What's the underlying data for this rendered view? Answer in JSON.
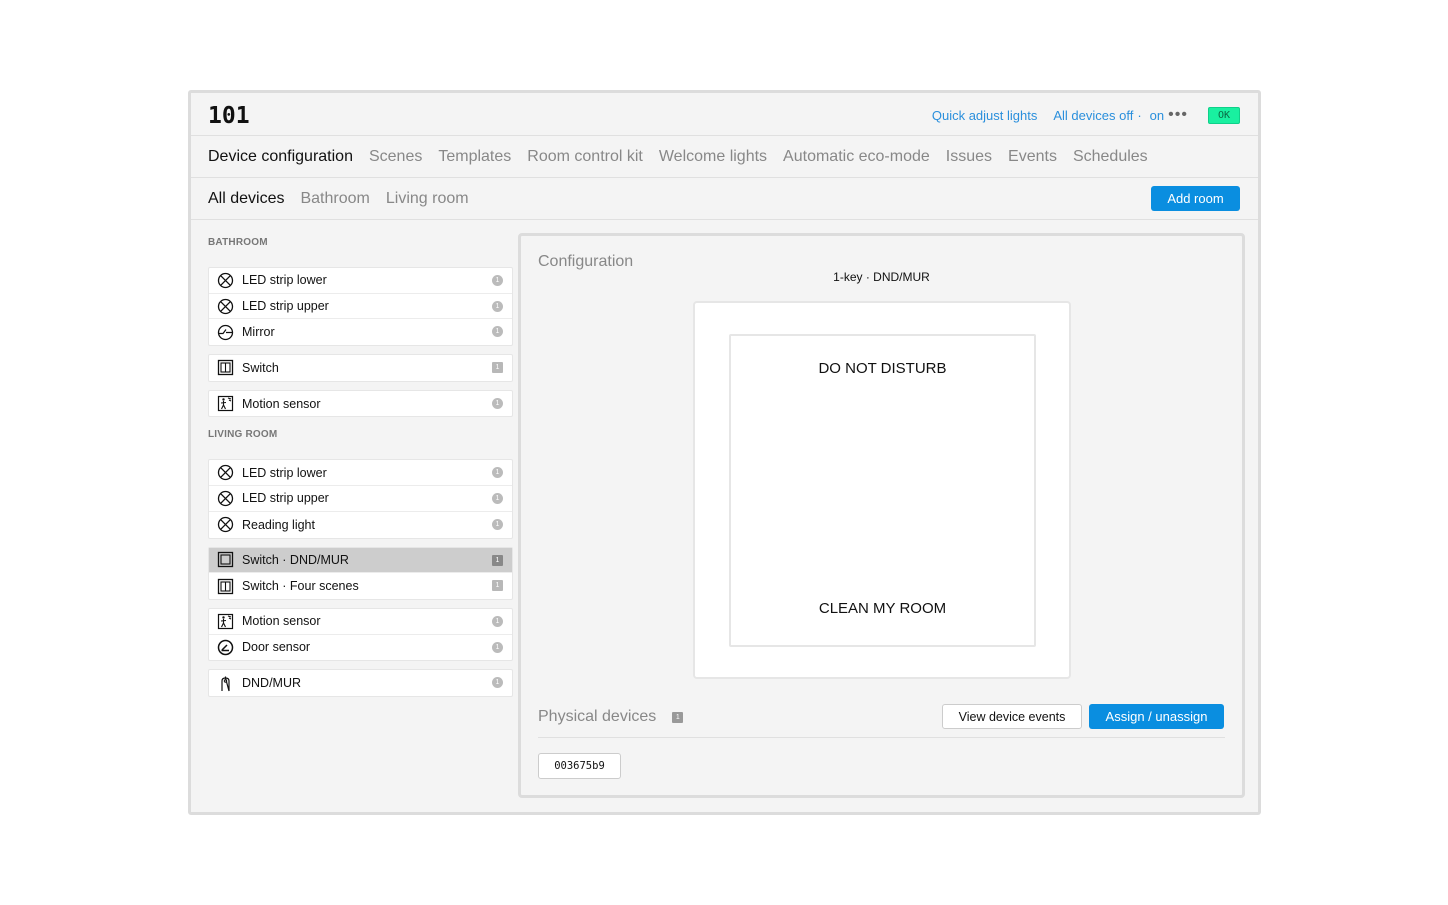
{
  "header": {
    "title": "101",
    "quick_adjust": "Quick adjust lights",
    "all_off": "All devices off",
    "sep": "·",
    "on": "on",
    "more": "•••",
    "status": "OK"
  },
  "tabs": [
    "Device configuration",
    "Scenes",
    "Templates",
    "Room control kit",
    "Welcome lights",
    "Automatic eco-mode",
    "Issues",
    "Events",
    "Schedules"
  ],
  "subtabs": [
    "All devices",
    "Bathroom",
    "Living room"
  ],
  "add_room": "Add room",
  "sidebar": {
    "bathroom": {
      "label": "BATHROOM",
      "groups": [
        [
          {
            "icon": "light",
            "label": "LED strip lower",
            "badge": "1"
          },
          {
            "icon": "light",
            "label": "LED strip upper",
            "badge": "1"
          },
          {
            "icon": "dimmer",
            "label": "Mirror",
            "badge": "1"
          }
        ],
        [
          {
            "icon": "switch",
            "label": "Switch",
            "badge": "1"
          }
        ],
        [
          {
            "icon": "motion",
            "label": "Motion sensor",
            "badge": "1"
          }
        ]
      ]
    },
    "living": {
      "label": "LIVING ROOM",
      "groups": [
        [
          {
            "icon": "light",
            "label": "LED strip lower",
            "badge": "1"
          },
          {
            "icon": "light",
            "label": "LED strip upper",
            "badge": "1"
          },
          {
            "icon": "light",
            "label": "Reading light",
            "badge": "1"
          }
        ],
        [
          {
            "icon": "switch1",
            "label": "Switch · DND/MUR",
            "badge": "1"
          },
          {
            "icon": "switch",
            "label": "Switch · Four scenes",
            "badge": "1"
          }
        ],
        [
          {
            "icon": "motion",
            "label": "Motion sensor",
            "badge": "1"
          },
          {
            "icon": "door",
            "label": "Door sensor",
            "badge": "1"
          }
        ],
        [
          {
            "icon": "hanger",
            "label": "DND/MUR",
            "badge": "1"
          }
        ]
      ]
    }
  },
  "config": {
    "title": "Configuration",
    "subtitle": "1-key · DND/MUR",
    "key_top": "DO NOT DISTURB",
    "key_bottom": "CLEAN MY ROOM",
    "physical_title": "Physical devices",
    "physical_count": "1",
    "view_events": "View device events",
    "assign": "Assign / unassign",
    "device_id": "003675b9"
  }
}
